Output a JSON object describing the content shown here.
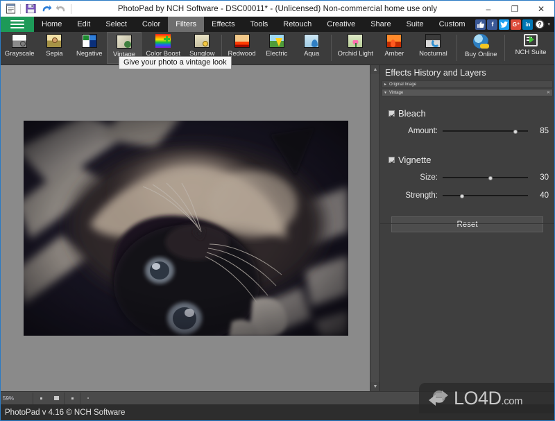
{
  "window": {
    "title": "PhotoPad by NCH Software - DSC00011* - (Unlicensed) Non-commercial home use only",
    "minimize_label": "–",
    "maximize_label": "❐",
    "close_label": "✕"
  },
  "quick_access": [
    {
      "name": "new-document-icon",
      "label": ""
    },
    {
      "name": "save-icon",
      "label": ""
    },
    {
      "name": "undo-icon",
      "label": ""
    },
    {
      "name": "redo-icon",
      "label": ""
    }
  ],
  "menubar": {
    "hamburger_label": "",
    "items": [
      {
        "label": "Home",
        "active": false
      },
      {
        "label": "Edit",
        "active": false
      },
      {
        "label": "Select",
        "active": false
      },
      {
        "label": "Color",
        "active": false
      },
      {
        "label": "Filters",
        "active": true
      },
      {
        "label": "Effects",
        "active": false
      },
      {
        "label": "Tools",
        "active": false
      },
      {
        "label": "Retouch",
        "active": false
      },
      {
        "label": "Creative",
        "active": false
      },
      {
        "label": "Share",
        "active": false
      },
      {
        "label": "Suite",
        "active": false
      },
      {
        "label": "Custom",
        "active": false
      }
    ],
    "social": [
      {
        "name": "thumbs-up-icon",
        "glyph": "👍",
        "color": "#3b5998"
      },
      {
        "name": "facebook-icon",
        "glyph": "f",
        "color": "#3b5998"
      },
      {
        "name": "twitter-icon",
        "glyph": "ᴛ",
        "color": "#1da1f2"
      },
      {
        "name": "google-plus-icon",
        "glyph": "G⁺",
        "color": "#dd4b39"
      },
      {
        "name": "linkedin-icon",
        "glyph": "in",
        "color": "#0077b5"
      },
      {
        "name": "help-icon",
        "glyph": "?",
        "color": "#555555"
      }
    ],
    "social_caret": "▾"
  },
  "ribbon": {
    "tools": [
      {
        "label": "Grayscale",
        "icon": "grayscale-icon"
      },
      {
        "label": "Sepia",
        "icon": "sepia-icon"
      },
      {
        "label": "Negative",
        "icon": "negative-icon"
      },
      {
        "label": "Vintage",
        "icon": "vintage-icon"
      },
      {
        "label": "Color Boost",
        "icon": "color-boost-icon"
      },
      {
        "label": "Sunglow",
        "icon": "sunglow-icon"
      },
      {
        "label": "Redwood",
        "icon": "redwood-icon"
      },
      {
        "label": "Electric",
        "icon": "electric-icon"
      },
      {
        "label": "Aqua",
        "icon": "aqua-icon"
      },
      {
        "label": "Orchid Light",
        "icon": "orchid-light-icon"
      },
      {
        "label": "Amber",
        "icon": "amber-icon"
      },
      {
        "label": "Nocturnal",
        "icon": "nocturnal-icon"
      },
      {
        "label": "Buy Online",
        "icon": "buy-online-icon"
      },
      {
        "label": "NCH Suite",
        "icon": "nch-suite-icon"
      }
    ]
  },
  "tooltip": {
    "text": "Give your photo a vintage look"
  },
  "panel": {
    "title": "Effects History and Layers",
    "layers": [
      {
        "name": "Original Image",
        "selected": false,
        "closable": false,
        "tri": "▸"
      },
      {
        "name": "Vintage",
        "selected": true,
        "closable": true,
        "tri": "▾",
        "close": "✕"
      }
    ],
    "groups": [
      {
        "name": "Bleach",
        "checked": true,
        "sliders": [
          {
            "label": "Amount:",
            "value": 85,
            "min": 0,
            "max": 100
          }
        ]
      },
      {
        "name": "Vignette",
        "checked": true,
        "sliders": [
          {
            "label": "Size:",
            "value": 30,
            "min": 0,
            "max": 100
          },
          {
            "label": "Strength:",
            "value": 40,
            "min": 0,
            "max": 100
          }
        ]
      }
    ],
    "reset_label": "Reset"
  },
  "bottombar": {
    "zoom_percent": "59%"
  },
  "statusbar": {
    "text": "PhotoPad v 4.16 © NCH Software"
  },
  "watermark": {
    "text": "LO4D",
    "suffix": ".com"
  },
  "canvas": {
    "image_alt": "Siamese cat lying on its back on a striped blanket, vintage bleach and vignette filter applied"
  },
  "colors": {
    "accent_green": "#1d9a58",
    "window_border": "#2b7bc4",
    "panel_bg": "#3f3f3f",
    "canvas_bg": "#8a8a8a",
    "ribbon_bg": "#3c3c3c",
    "menubar_bg": "#1c1c1c",
    "status_bg": "#2d2d2d"
  }
}
